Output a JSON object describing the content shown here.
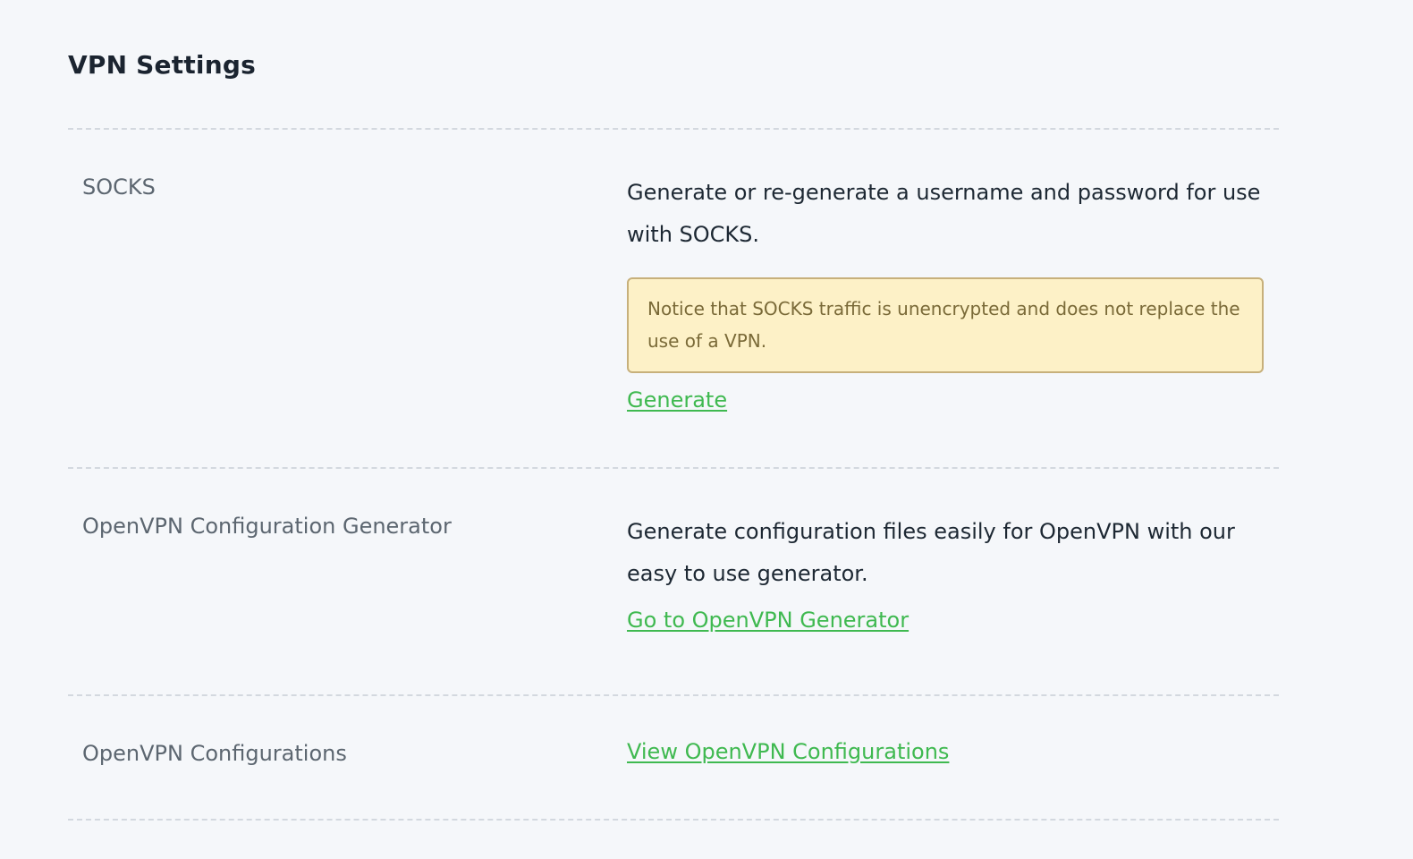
{
  "page": {
    "title": "VPN Settings"
  },
  "settings": {
    "socks": {
      "label": "SOCKS",
      "description": "Generate or re-generate a username and password for use with SOCKS.",
      "notice": "Notice that SOCKS traffic is unencrypted and does not replace the use of a VPN.",
      "action_label": "Generate"
    },
    "openvpn_generator": {
      "label": "OpenVPN Configuration Generator",
      "description": "Generate configuration files easily for OpenVPN with our easy to use generator.",
      "action_label": "Go to OpenVPN Generator"
    },
    "openvpn_configurations": {
      "label": "OpenVPN Configurations",
      "action_label": "View OpenVPN Configurations"
    }
  },
  "colors": {
    "background": "#f5f7fa",
    "link": "#3fb950",
    "notice_background": "#fdf1c7",
    "notice_border": "#c7b07b",
    "notice_text": "#7a6a38",
    "label_text": "#5c6670"
  }
}
